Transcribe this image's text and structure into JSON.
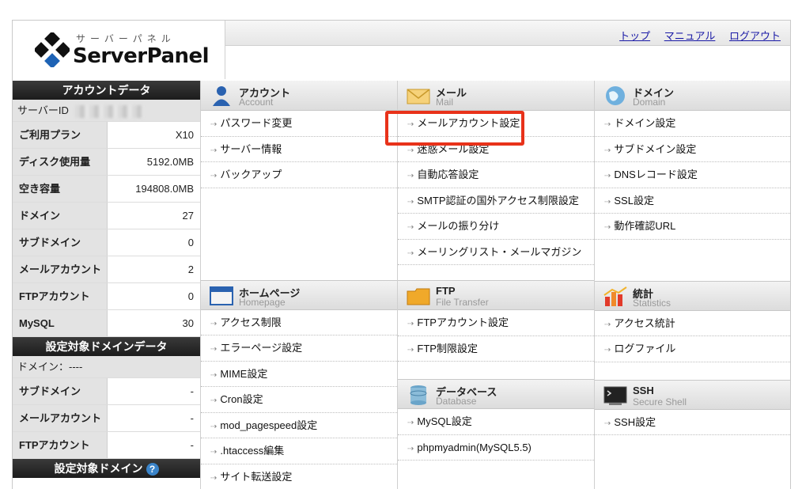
{
  "header": {
    "logo_sub": "サーバーパネル",
    "logo_main": "ServerPanel",
    "links": [
      "トップ",
      "マニュアル",
      "ログアウト"
    ]
  },
  "sidebar": {
    "account_title": "アカウントデータ",
    "server_id_label": "サーバーID",
    "account_rows": [
      {
        "k": "ご利用プラン",
        "v": "X10"
      },
      {
        "k": "ディスク使用量",
        "v": "5192.0MB"
      },
      {
        "k": "空き容量",
        "v": "194808.0MB"
      },
      {
        "k": "ドメイン",
        "v": "27"
      },
      {
        "k": "サブドメイン",
        "v": "0"
      },
      {
        "k": "メールアカウント",
        "v": "2"
      },
      {
        "k": "FTPアカウント",
        "v": "0"
      },
      {
        "k": "MySQL",
        "v": "30"
      }
    ],
    "domain_data_title": "設定対象ドメインデータ",
    "domain_label": "ドメイン：----",
    "domain_rows": [
      {
        "k": "サブドメイン",
        "v": "-"
      },
      {
        "k": "メールアカウント",
        "v": "-"
      },
      {
        "k": "FTPアカウント",
        "v": "-"
      }
    ],
    "target_domain_title": "設定対象ドメイン",
    "help_glyph": "?"
  },
  "sections": {
    "account": {
      "t1": "アカウント",
      "t2": "Account",
      "items": [
        "パスワード変更",
        "サーバー情報",
        "バックアップ"
      ]
    },
    "mail": {
      "t1": "メール",
      "t2": "Mail",
      "items": [
        "メールアカウント設定",
        "迷惑メール設定",
        "自動応答設定",
        "SMTP認証の国外アクセス制限設定",
        "メールの振り分け",
        "メーリングリスト・メールマガジン"
      ]
    },
    "domain": {
      "t1": "ドメイン",
      "t2": "Domain",
      "items": [
        "ドメイン設定",
        "サブドメイン設定",
        "DNSレコード設定",
        "SSL設定",
        "動作確認URL"
      ]
    },
    "homepage": {
      "t1": "ホームページ",
      "t2": "Homepage",
      "items": [
        "アクセス制限",
        "エラーページ設定",
        "MIME設定",
        "Cron設定",
        "mod_pagespeed設定",
        ".htaccess編集",
        "サイト転送設定"
      ]
    },
    "ftp": {
      "t1": "FTP",
      "t2": "File Transfer",
      "items": [
        "FTPアカウント設定",
        "FTP制限設定"
      ]
    },
    "database": {
      "t1": "データベース",
      "t2": "Database",
      "items": [
        "MySQL設定",
        "phpmyadmin(MySQL5.5)"
      ]
    },
    "stats": {
      "t1": "統計",
      "t2": "Statistics",
      "items": [
        "アクセス統計",
        "ログファイル"
      ]
    },
    "ssh": {
      "t1": "SSH",
      "t2": "Secure Shell",
      "items": [
        "SSH設定"
      ]
    }
  },
  "colors": {
    "highlight": "#e8321a",
    "link": "#1a1aa6"
  }
}
